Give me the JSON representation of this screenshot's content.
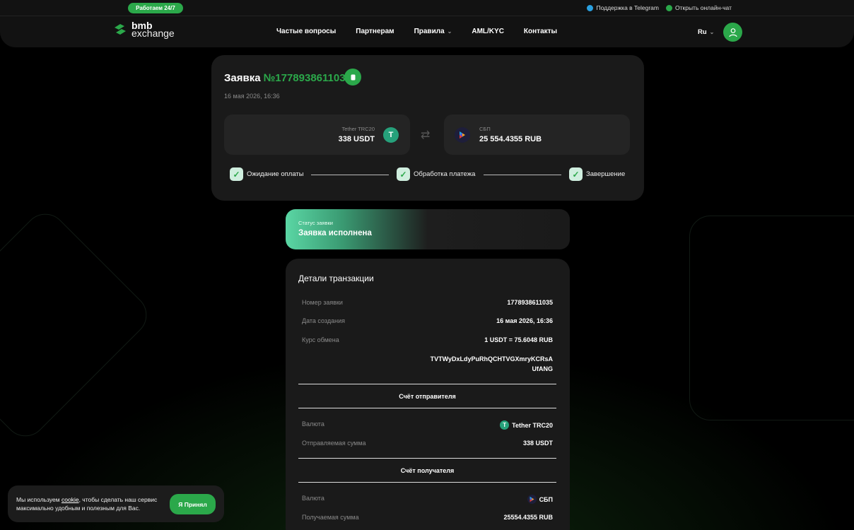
{
  "header": {
    "badge": "Работаем 24/7",
    "telegram_link": "Поддержка в Telegram",
    "chat_link": "Открыть онлайн-чат",
    "logo_top": "bmb",
    "logo_bottom": "exchange",
    "nav": [
      {
        "label": "Частые вопросы"
      },
      {
        "label": "Партнерам"
      },
      {
        "label": "Правила"
      },
      {
        "label": "AML/KYC"
      },
      {
        "label": "Контакты"
      }
    ],
    "lang": "Ru"
  },
  "order": {
    "title_prefix": "Заявка",
    "number": "№1778938611035",
    "date": "16 мая 2026, 16:36",
    "from": {
      "name": "Tether TRC20",
      "amount": "338 USDT"
    },
    "to": {
      "name": "СБП",
      "amount": "25 554.4355 RUB"
    },
    "steps": [
      {
        "label": "Ожидание оплаты"
      },
      {
        "label": "Обработка платежа"
      },
      {
        "label": "Завершение"
      }
    ]
  },
  "status": {
    "label": "Статус заявки",
    "text": "Заявка исполнена"
  },
  "details": {
    "title": "Детали транзакции",
    "rows": [
      {
        "key": "Номер заявки",
        "value": "1778938611035"
      },
      {
        "key": "Дата создания",
        "value": "16 мая 2026, 16:36"
      },
      {
        "key": "Курс обмена",
        "value": "1 USDT = 75.6048 RUB"
      }
    ],
    "wallet_line1": "TVTWyDxLdyPuRhQCHTVGXmryKCRsA",
    "wallet_line2": "UfANG",
    "sender": {
      "title": "Счёт отправителя",
      "currency_key": "Валюта",
      "currency_value": "Tether TRC20",
      "amount_key": "Отправляемая сумма",
      "amount_value": "338 USDT"
    },
    "receiver": {
      "title": "Счёт получателя",
      "currency_key": "Валюта",
      "currency_value": "СБП",
      "amount_key": "Получаемая сумма",
      "amount_value": "25554.4355 RUB"
    }
  },
  "cookie": {
    "text_before": "Мы используем ",
    "link": "cookie",
    "text_after": ", чтобы сделать наш сервис максимально удобным и полезным для Вас.",
    "button": "Я Принял"
  },
  "colors": {
    "accent": "#2ba84a",
    "card": "#1a1a1a",
    "background": "#000000"
  }
}
